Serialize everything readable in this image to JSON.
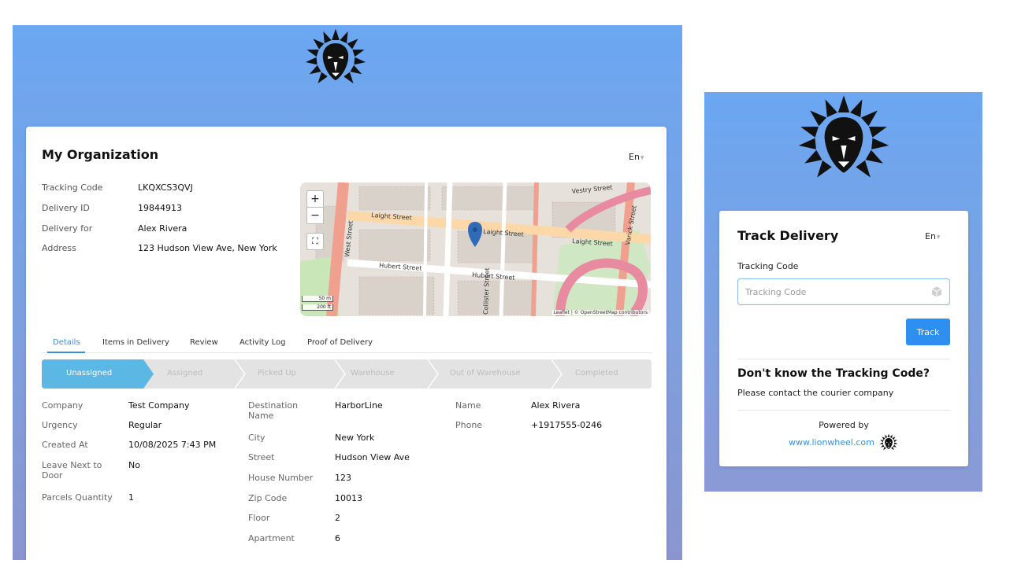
{
  "org": {
    "title": "My Organization",
    "language": "En",
    "info": [
      {
        "label": "Tracking Code",
        "value": "LKQXCS3QVJ"
      },
      {
        "label": "Delivery ID",
        "value": "19844913"
      },
      {
        "label": "Delivery for",
        "value": "Alex Rivera"
      },
      {
        "label": "Address",
        "value": "123 Hudson View Ave, New York"
      }
    ]
  },
  "map": {
    "zoom_in": "+",
    "zoom_out": "−",
    "fullscreen": "⛶",
    "scale_m": "50 m",
    "scale_ft": "200 ft",
    "attribution": "Leaflet | © OpenStreetMap contributors",
    "streets": [
      "Laight Street",
      "Laight Street",
      "Laight Street",
      "Hubert Street",
      "Hubert Street",
      "Vestry Street",
      "West Street",
      "Varick Street",
      "Collister Street"
    ],
    "pin_color": "#2f6cb8"
  },
  "tabs": [
    "Details",
    "Items in Delivery",
    "Review",
    "Activity Log",
    "Proof of Delivery"
  ],
  "active_tab": "Details",
  "steps": [
    "Unassigned",
    "Assigned",
    "Picked Up",
    "Warehouse",
    "Out of Warehouse",
    "Completed"
  ],
  "active_step": "Unassigned",
  "details": {
    "col1": [
      {
        "label": "Company",
        "value": "Test Company"
      },
      {
        "label": "Urgency",
        "value": "Regular"
      },
      {
        "label": "Created At",
        "value": "10/08/2025 7:43 PM"
      },
      {
        "label": "Leave Next to",
        "label2": "Door",
        "value": "No"
      },
      {
        "label": "Parcels Quantity",
        "value": "1"
      }
    ],
    "col2": [
      {
        "label": "Destination",
        "label2": "Name",
        "value": "HarborLine"
      },
      {
        "label": "City",
        "value": "New York"
      },
      {
        "label": "Street",
        "value": "Hudson View Ave"
      },
      {
        "label": "House Number",
        "value": "123"
      },
      {
        "label": "Zip Code",
        "value": "10013"
      },
      {
        "label": "Floor",
        "value": "2"
      },
      {
        "label": "Apartment",
        "value": "6"
      }
    ],
    "col3": [
      {
        "label": "Name",
        "value": "Alex Rivera"
      },
      {
        "label": "Phone",
        "value": "+1917555-0246"
      }
    ]
  },
  "track": {
    "title": "Track Delivery",
    "language": "En",
    "code_label": "Tracking Code",
    "code_placeholder": "Tracking Code",
    "code_value": "",
    "button": "Track",
    "dont_know_title": "Don't know the Tracking Code?",
    "dont_know_text": "Please contact the courier company",
    "powered_by": "Powered by",
    "link": "www.lionwheel.com"
  },
  "colors": {
    "accent": "#3a8fd6",
    "button": "#2d8ff0",
    "step_active": "#5bb8e4",
    "step_inactive": "#e3e3e3",
    "header_gradient_top": "#6ba7f2"
  }
}
